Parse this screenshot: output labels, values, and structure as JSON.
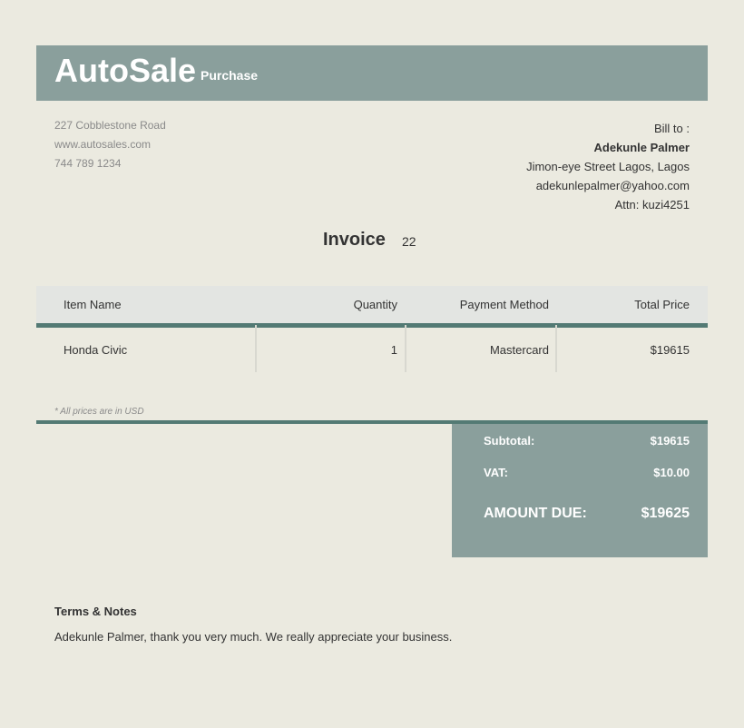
{
  "header": {
    "brand": "AutoSale",
    "subtitle": "Purchase"
  },
  "company": {
    "address": "227 Cobblestone Road",
    "website": "www.autosales.com",
    "phone": "744 789 1234"
  },
  "bill_to": {
    "label": "Bill to :",
    "name": "Adekunle Palmer",
    "address": "Jimon-eye Street Lagos, Lagos",
    "email": "adekunlepalmer@yahoo.com",
    "attn": "Attn: kuzi4251"
  },
  "invoice": {
    "title": "Invoice",
    "number": "22"
  },
  "items_table": {
    "headers": [
      "Item Name",
      "Quantity",
      "Payment Method",
      "Total Price"
    ],
    "rows": [
      [
        "Honda Civic",
        "1",
        "Mastercard",
        "$19615"
      ]
    ]
  },
  "note": "* All prices are in USD",
  "totals": {
    "subtotal_label": "Subtotal:",
    "subtotal_value": "$19615",
    "vat_label": "VAT:",
    "vat_value": "$10.00",
    "due_label": "AMOUNT DUE:",
    "due_value": "$19625"
  },
  "terms": {
    "title": "Terms & Notes",
    "text": "Adekunle Palmer, thank you very much. We really appreciate your business."
  },
  "colors": {
    "accent": "#8a9f9c",
    "rule": "#537a74",
    "background": "#ebeae0"
  }
}
